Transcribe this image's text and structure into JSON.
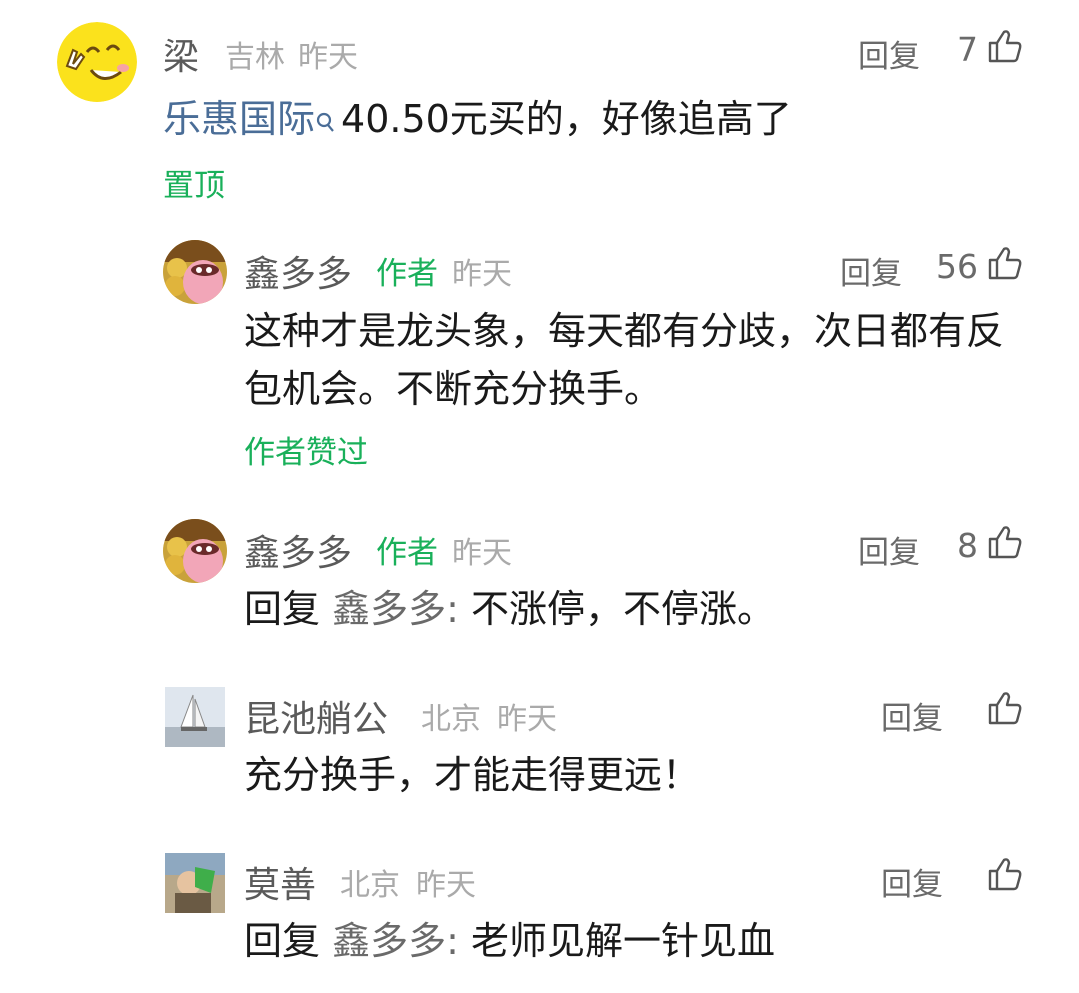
{
  "comments": [
    {
      "user": "梁",
      "location": "吉林",
      "time": "昨天",
      "reply_label": "回复",
      "likes": "7",
      "stock_link": "乐惠国际",
      "text": "40.50元买的，好像追高了",
      "badge": "置顶"
    },
    {
      "user": "鑫多多",
      "author_tag": "作者",
      "time": "昨天",
      "reply_label": "回复",
      "likes": "56",
      "text": "这种才是龙头象，每天都有分歧，次日都有反包机会。不断充分换手。",
      "badge": "作者赞过"
    },
    {
      "user": "鑫多多",
      "author_tag": "作者",
      "time": "昨天",
      "reply_label": "回复",
      "likes": "8",
      "reply_prefix": "回复",
      "reply_target": "鑫多多:",
      "text": "不涨停，不停涨。"
    },
    {
      "user": "昆池艄公",
      "location": "北京",
      "time": "昨天",
      "reply_label": "回复",
      "text": "充分换手，才能走得更远！"
    },
    {
      "user": "莫善",
      "location": "北京",
      "time": "昨天",
      "reply_label": "回复",
      "reply_prefix": "回复",
      "reply_target": "鑫多多:",
      "text": "老师见解一针见血"
    }
  ],
  "colors": {
    "green": "#19b05a",
    "stock_link": "#4a6d97",
    "meta_gray": "#aaaaaa"
  }
}
